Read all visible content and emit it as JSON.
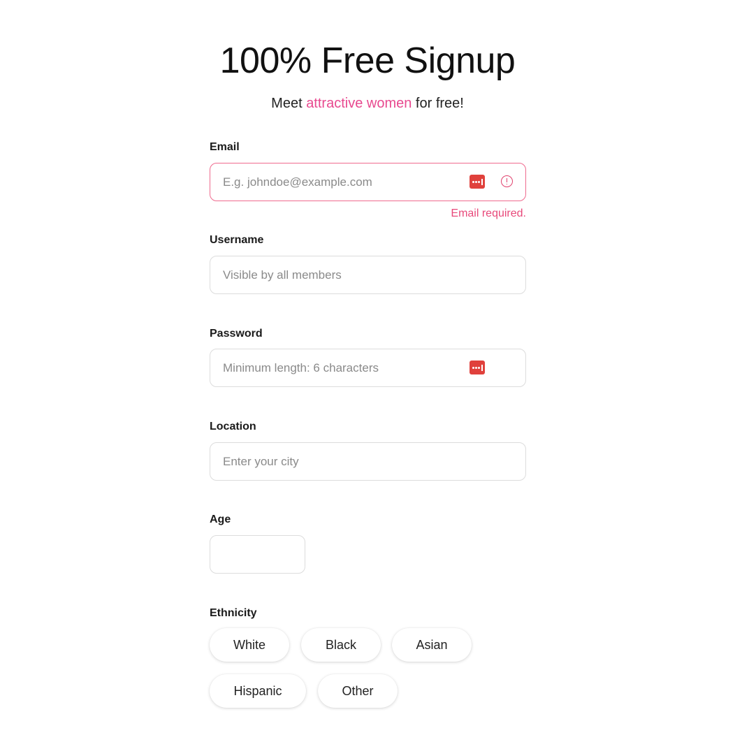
{
  "header": {
    "title": "100% Free Signup",
    "subtitle_before": "Meet ",
    "subtitle_accent": "attractive women",
    "subtitle_after": " for free!"
  },
  "form": {
    "email": {
      "label": "Email",
      "placeholder": "E.g. johndoe@example.com",
      "value": "",
      "error": "Email required."
    },
    "username": {
      "label": "Username",
      "placeholder": "Visible by all members",
      "value": ""
    },
    "password": {
      "label": "Password",
      "placeholder": "Minimum length: 6 characters",
      "value": ""
    },
    "location": {
      "label": "Location",
      "placeholder": "Enter your city",
      "value": ""
    },
    "age": {
      "label": "Age",
      "placeholder": "",
      "value": ""
    },
    "ethnicity": {
      "label": "Ethnicity",
      "options": [
        "White",
        "Black",
        "Asian",
        "Hispanic",
        "Other"
      ]
    }
  },
  "colors": {
    "accent": "#e8498f",
    "error": "#e8497a",
    "password_manager_icon": "#e0413c"
  },
  "icons": {
    "password_manager": "password-manager-icon",
    "error": "error-circle-icon"
  }
}
